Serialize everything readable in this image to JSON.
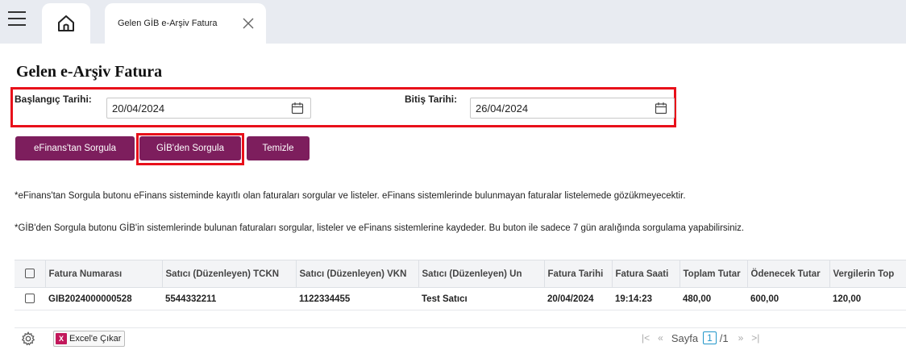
{
  "tabs": {
    "active_label": "Gelen GİB e-Arşiv Fatura"
  },
  "page": {
    "title": "Gelen e-Arşiv Fatura"
  },
  "filters": {
    "start_label": "Başlangıç Tarihi:",
    "start_value": "20/04/2024",
    "end_label": "Bitiş Tarihi:",
    "end_value": "26/04/2024"
  },
  "actions": {
    "efinans_query": "eFinans'tan Sorgula",
    "gib_query": "GİB'den Sorgula",
    "clear": "Temizle"
  },
  "info": {
    "line1": "*eFinans'tan Sorgula butonu eFinans sisteminde kayıtlı olan faturaları sorgular ve listeler. eFinans sistemlerinde bulunmayan faturalar listelemede gözükmeyecektir.",
    "line2": "*GİB'den Sorgula butonu GİB'in sistemlerinde bulunan faturaları sorgular, listeler ve eFinans sistemlerine kaydeder. Bu buton ile sadece 7 gün aralığında sorgulama yapabilirsiniz."
  },
  "table": {
    "headers": [
      "Fatura Numarası",
      "Satıcı (Düzenleyen) TCKN",
      "Satıcı (Düzenleyen) VKN",
      "Satıcı (Düzenleyen) Un",
      "Fatura Tarihi",
      "Fatura Saati",
      "Toplam Tutar",
      "Ödenecek Tutar",
      "Vergilerin Top"
    ],
    "rows": [
      [
        "GIB2024000000528",
        "5544332211",
        "1122334455",
        "Test Satıcı",
        "20/04/2024",
        "19:14:23",
        "480,00",
        "600,00",
        "120,00"
      ]
    ]
  },
  "footer": {
    "excel_label": "Excel'e Çıkar",
    "page_label": "Sayfa",
    "current_page": "1",
    "total_pages": "/1"
  },
  "colors": {
    "accent": "#7d1e5d",
    "highlight": "#e8101a",
    "topbar": "#e8ebf1"
  }
}
